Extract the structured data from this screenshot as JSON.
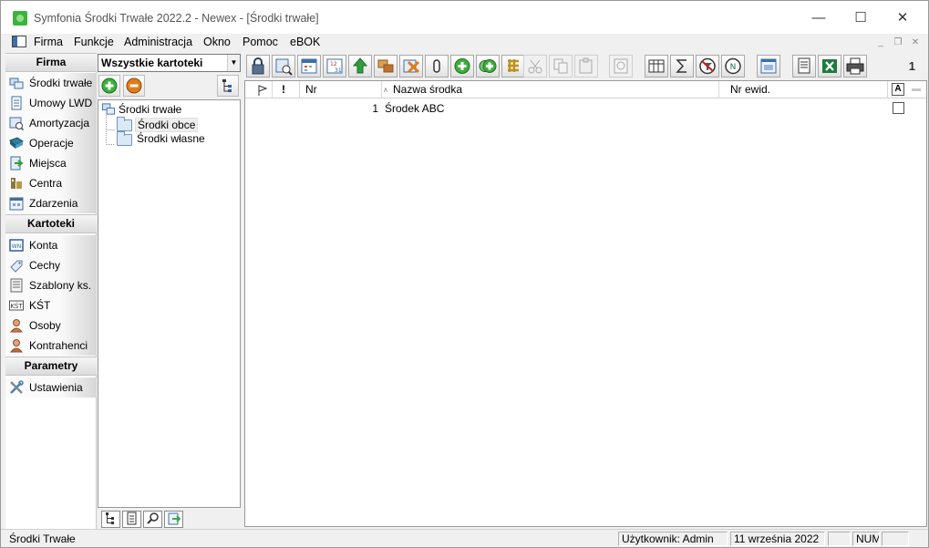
{
  "window": {
    "title": "Symfonia Środki Trwałe 2022.2 - Newex - [Środki trwałe]",
    "controls": [
      "—",
      "☐",
      "✕"
    ]
  },
  "menu": {
    "items": [
      "Firma",
      "Funkcje",
      "Administracja",
      "Okno",
      "Pomoc",
      "eBOK"
    ],
    "mdi_controls": [
      "_",
      "❐",
      "✕"
    ]
  },
  "sidebar": {
    "sections": [
      {
        "header": "Firma",
        "items": [
          {
            "label": "Środki trwałe",
            "icon": "fixed-assets-icon"
          },
          {
            "label": "Umowy LWD",
            "icon": "contract-icon"
          },
          {
            "label": "Amortyzacja",
            "icon": "depreciation-icon"
          },
          {
            "label": "Operacje",
            "icon": "operations-book-icon"
          },
          {
            "label": "Miejsca",
            "icon": "places-icon"
          },
          {
            "label": "Centra",
            "icon": "centers-icon"
          },
          {
            "label": "Zdarzenia",
            "icon": "events-icon"
          }
        ]
      },
      {
        "header": "Kartoteki",
        "items": [
          {
            "label": "Konta",
            "icon": "accounts-icon"
          },
          {
            "label": "Cechy",
            "icon": "tag-icon"
          },
          {
            "label": "Szablony ks.",
            "icon": "templates-icon"
          },
          {
            "label": "KŚT",
            "icon": "kst-icon"
          },
          {
            "label": "Osoby",
            "icon": "person-icon"
          },
          {
            "label": "Kontrahenci",
            "icon": "contractor-icon"
          }
        ]
      },
      {
        "header": "Parametry",
        "items": [
          {
            "label": "Ustawienia",
            "icon": "settings-tools-icon"
          }
        ]
      }
    ]
  },
  "tree_panel": {
    "filter": {
      "selected": "Wszystkie kartoteki"
    },
    "tree": {
      "root": "Środki trwałe",
      "children": [
        "Środki obce",
        "Środki własne"
      ]
    },
    "bottom_tabs": [
      "tree-view-icon",
      "document-icon",
      "search-icon",
      "export-icon"
    ]
  },
  "toolbar": {
    "page_number": "1",
    "colors": {
      "add": "#3cae3c",
      "remove": "#e07b1f",
      "excel": "#1f7a3d"
    }
  },
  "list": {
    "columns": [
      "",
      "!",
      "Nr",
      "Nazwa środka",
      "Nr ewid."
    ],
    "header_button": "A",
    "rows": [
      {
        "nr": "1",
        "name": "Środek ABC",
        "nr_ewid": ""
      }
    ]
  },
  "status": {
    "left": "Środki Trwałe",
    "user": "Użytkownik: Admin",
    "date": "11 września 2022",
    "empty": "",
    "num": "NUM"
  }
}
